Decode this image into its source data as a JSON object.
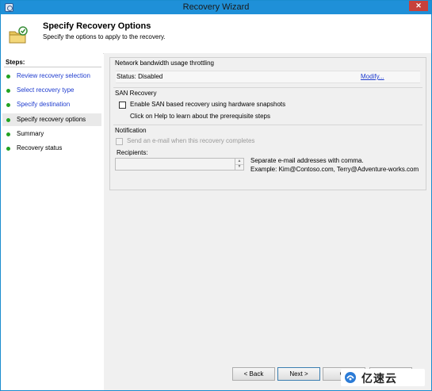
{
  "window": {
    "title": "Recovery Wizard",
    "close_glyph": "✕"
  },
  "header": {
    "heading": "Specify Recovery Options",
    "subheading": "Specify the options to apply to the recovery."
  },
  "sidebar": {
    "steps_label": "Steps:",
    "items": [
      {
        "label": "Review recovery selection",
        "state": "link",
        "dot_color": "#22a322"
      },
      {
        "label": "Select recovery type",
        "state": "link",
        "dot_color": "#22a322"
      },
      {
        "label": "Specify destination",
        "state": "link",
        "dot_color": "#22a322"
      },
      {
        "label": "Specify recovery options",
        "state": "current",
        "dot_color": "#22a322"
      },
      {
        "label": "Summary",
        "state": "normal",
        "dot_color": "#22a322"
      },
      {
        "label": "Recovery status",
        "state": "normal",
        "dot_color": "#22a322"
      }
    ]
  },
  "bandwidth": {
    "title": "Network bandwidth usage throttling",
    "status": "Status: Disabled",
    "modify_link": "Modify..."
  },
  "san": {
    "title": "SAN Recovery",
    "checkbox_label": "Enable SAN based recovery using hardware snapshots",
    "checked": false,
    "help_text": "Click on Help to learn about the prerequisite steps"
  },
  "notification": {
    "title": "Notification",
    "checkbox_label": "Send an e-mail when this recovery completes",
    "checked": false,
    "enabled": false,
    "recipients_label": "Recipients:",
    "recipients_value": "",
    "hint_line1": "Separate e-mail addresses with comma.",
    "hint_line2": "Example: Kim@Contoso.com, Terry@Adventure-works.com"
  },
  "footer": {
    "back_label": "< Back",
    "next_label": "Next >",
    "cancel_label": "Ca"
  },
  "watermark": {
    "text": "亿速云"
  }
}
